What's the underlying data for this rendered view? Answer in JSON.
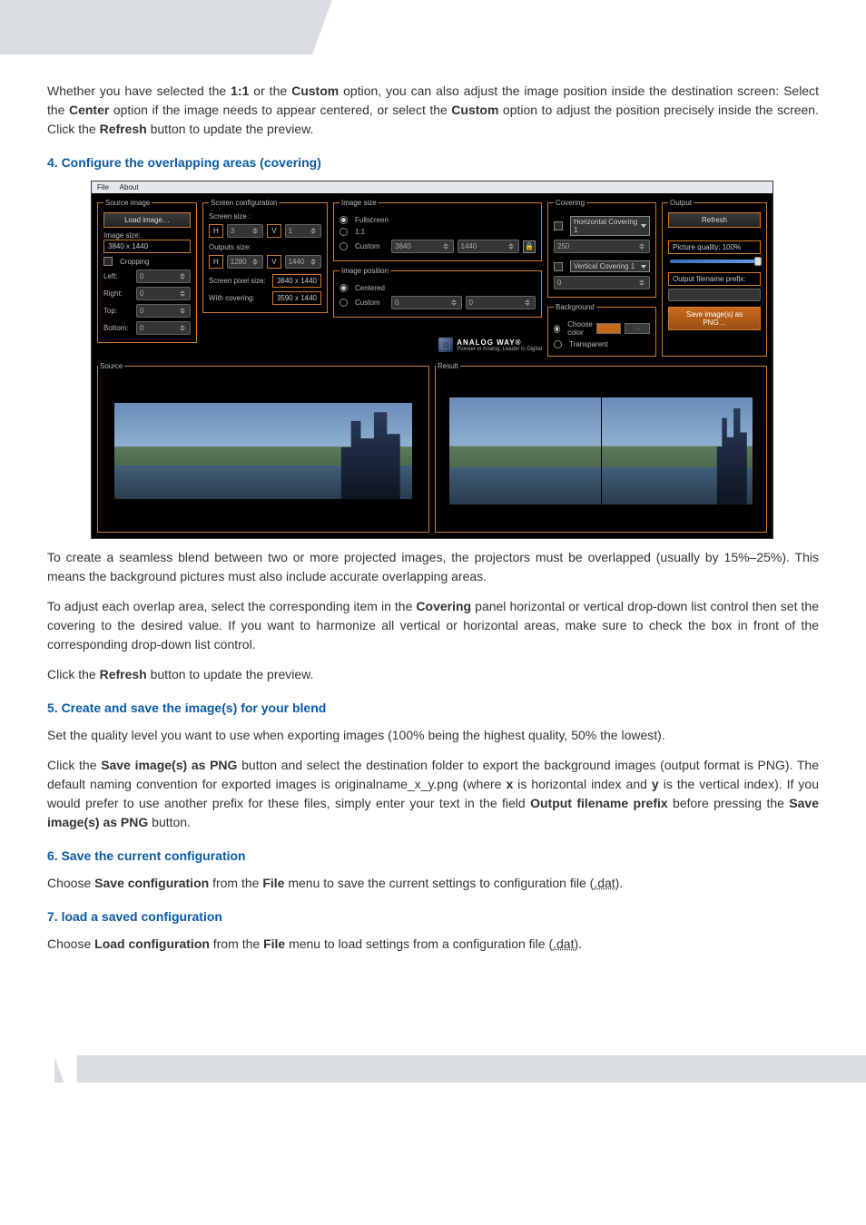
{
  "intro": {
    "p1_a": "Whether you have selected the ",
    "p1_b": " or the ",
    "p1_c": " option, you can also adjust the image position inside the destination screen: Select the ",
    "p1_d": " option if the image needs to appear centered, or select the ",
    "p1_e": " option to adjust the position precisely inside the screen. Click the ",
    "p1_f": " button to update the preview.",
    "b_11": "1:1",
    "b_custom": "Custom",
    "b_center": "Center",
    "b_refresh": "Refresh"
  },
  "h4": "4. Configure the overlapping areas (covering)",
  "app": {
    "menu": {
      "file": "File",
      "about": "About"
    },
    "source_image": {
      "legend": "Source image",
      "load_btn": "Load image…",
      "size_label": "Image size:",
      "size_value": "3840 x 1440",
      "cropping_label": "Cropping",
      "left_label": "Left:",
      "left_value": "0",
      "right_label": "Right:",
      "right_value": "0",
      "top_label": "Top:",
      "top_value": "0",
      "bottom_label": "Bottom:",
      "bottom_value": "0"
    },
    "screen_config": {
      "legend": "Screen configuration",
      "screen_size_label": "Screen size :",
      "h_label": "H",
      "h_value": "3",
      "v_label": "V",
      "v_value": "1",
      "outputs_size_label": "Outputs size:",
      "out_h_label": "H",
      "out_h_value": "1280",
      "out_v_label": "V",
      "out_v_value": "1440",
      "pixel_label": "Screen pixel size:",
      "pixel_value": "3840 x 1440",
      "covering_label": "With covering:",
      "covering_value": "3590 x 1440"
    },
    "image_size": {
      "legend": "Image size",
      "fullscreen": "Fullscreen",
      "one_to_one": "1:1",
      "custom": "Custom",
      "w": "3840",
      "h": "1440"
    },
    "image_pos": {
      "legend": "Image position",
      "centered": "Centered",
      "custom": "Custom",
      "x": "0",
      "y": "0"
    },
    "brand": {
      "title": "ANALOG WAY®",
      "sub": "Pioneer in Analog, Leader in Digital"
    },
    "covering": {
      "legend": "Covering",
      "h_select": "Horizontal Covering 1",
      "h_value": "250",
      "v_select": "Vertical Covering 1",
      "v_value": "0"
    },
    "background": {
      "legend": "Background",
      "choose": "Choose color",
      "transparent": "Transparent"
    },
    "output": {
      "legend": "Output",
      "refresh_btn": "Refresh",
      "quality_label": "Picture quality: 100%",
      "prefix_label": "Output filename prefix:",
      "prefix_value": "",
      "save_btn": "Save image(s) as PNG…"
    },
    "lower": {
      "source_legend": "Source",
      "result_legend": "Result"
    }
  },
  "seamless": {
    "p1": "To create a seamless blend between two or more projected images, the projectors must be overlapped (usually by 15%–25%). This means the background pictures must also include accurate overlapping areas.",
    "p2_a": "To adjust each overlap area, select the corresponding item in the ",
    "p2_b": " panel horizontal or vertical drop-down list control then set the covering to the desired value. If you want to harmonize all vertical or horizontal areas, make sure to check the box in front of the corresponding drop-down list control.",
    "b_covering": "Covering",
    "p3_a": "Click the ",
    "p3_b": " button to update the preview.",
    "b_refresh": "Refresh"
  },
  "h5": "5. Create and save the image(s) for your blend",
  "section5": {
    "p1": "Set the quality level you want to use when exporting images (100% being the highest quality, 50% the lowest).",
    "p2_a": "Click the ",
    "b_save": "Save image(s) as PNG",
    "p2_b": " button and select the destination folder to export the background images (output format is PNG). The default naming convention for exported images is originalname_x_y.png (where ",
    "b_x": "x",
    "p2_c": " is horizontal index and ",
    "b_y": "y",
    "p2_d": " is the vertical index). If you would prefer to use another prefix for these files, simply enter your text in the field ",
    "b_prefix": "Output filename prefix",
    "p2_e": " before pressing the ",
    "p2_f": " button."
  },
  "h6": "6. Save the current configuration",
  "section6": {
    "a": "Choose ",
    "b_save": "Save configuration",
    "b": " from the ",
    "b_file": "File",
    "c": " menu to save the current settings to configuration file (",
    "dat": ".dat",
    "d": ")."
  },
  "h7": "7. load a saved configuration",
  "section7": {
    "a": "Choose ",
    "b_load": "Load configuration",
    "b": " from the ",
    "b_file": "File",
    "c": " menu to load settings from a configuration file (",
    "dat": ".dat",
    "d": ")."
  }
}
